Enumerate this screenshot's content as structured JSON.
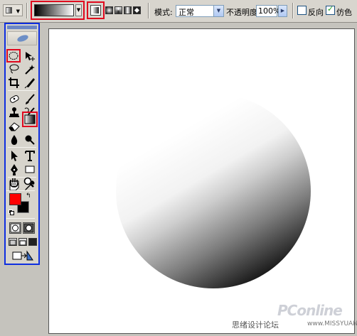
{
  "options_bar": {
    "mode_label": "模式:",
    "mode_value": "正常",
    "opacity_label": "不透明度:",
    "opacity_value": "100%",
    "reverse_label": "反向",
    "reverse_checked": false,
    "dither_label": "仿色",
    "dither_checked": true,
    "gradient_types": [
      "linear-gradient-icon",
      "radial-gradient-icon",
      "angle-gradient-icon",
      "reflected-gradient-icon",
      "diamond-gradient-icon"
    ],
    "selected_gradient_type": "linear",
    "gradient_preset": "foreground-to-background (black to white)"
  },
  "toolbox": {
    "accent_color": "#0e2ee0",
    "highlight_color": "#e0081e",
    "foreground_color": "#ff0000",
    "background_color": "#000000",
    "tools": [
      "elliptical-marquee-icon",
      "move-icon",
      "lasso-icon",
      "magic-wand-icon",
      "crop-icon",
      "slice-icon",
      "healing-brush-icon",
      "brush-icon",
      "clone-stamp-icon",
      "history-brush-icon",
      "eraser-icon",
      "gradient-icon",
      "blur-icon",
      "dodge-icon",
      "path-selection-icon",
      "type-icon",
      "pen-icon",
      "rectangle-shape-icon",
      "notes-icon",
      "eyedropper-icon",
      "hand-icon",
      "zoom-icon"
    ],
    "highlighted_tools": [
      "elliptical-marquee-icon",
      "gradient-icon"
    ]
  },
  "canvas": {
    "background": "#ffffff",
    "shape": "circle filled with linear gradient",
    "gradient_stops": [
      "#ffffff",
      "#d0d0d0",
      "#101010"
    ]
  },
  "watermark": {
    "brand": "PConline",
    "site_name": "思绪设计论坛",
    "url": "www.MISSYUAN.com"
  }
}
